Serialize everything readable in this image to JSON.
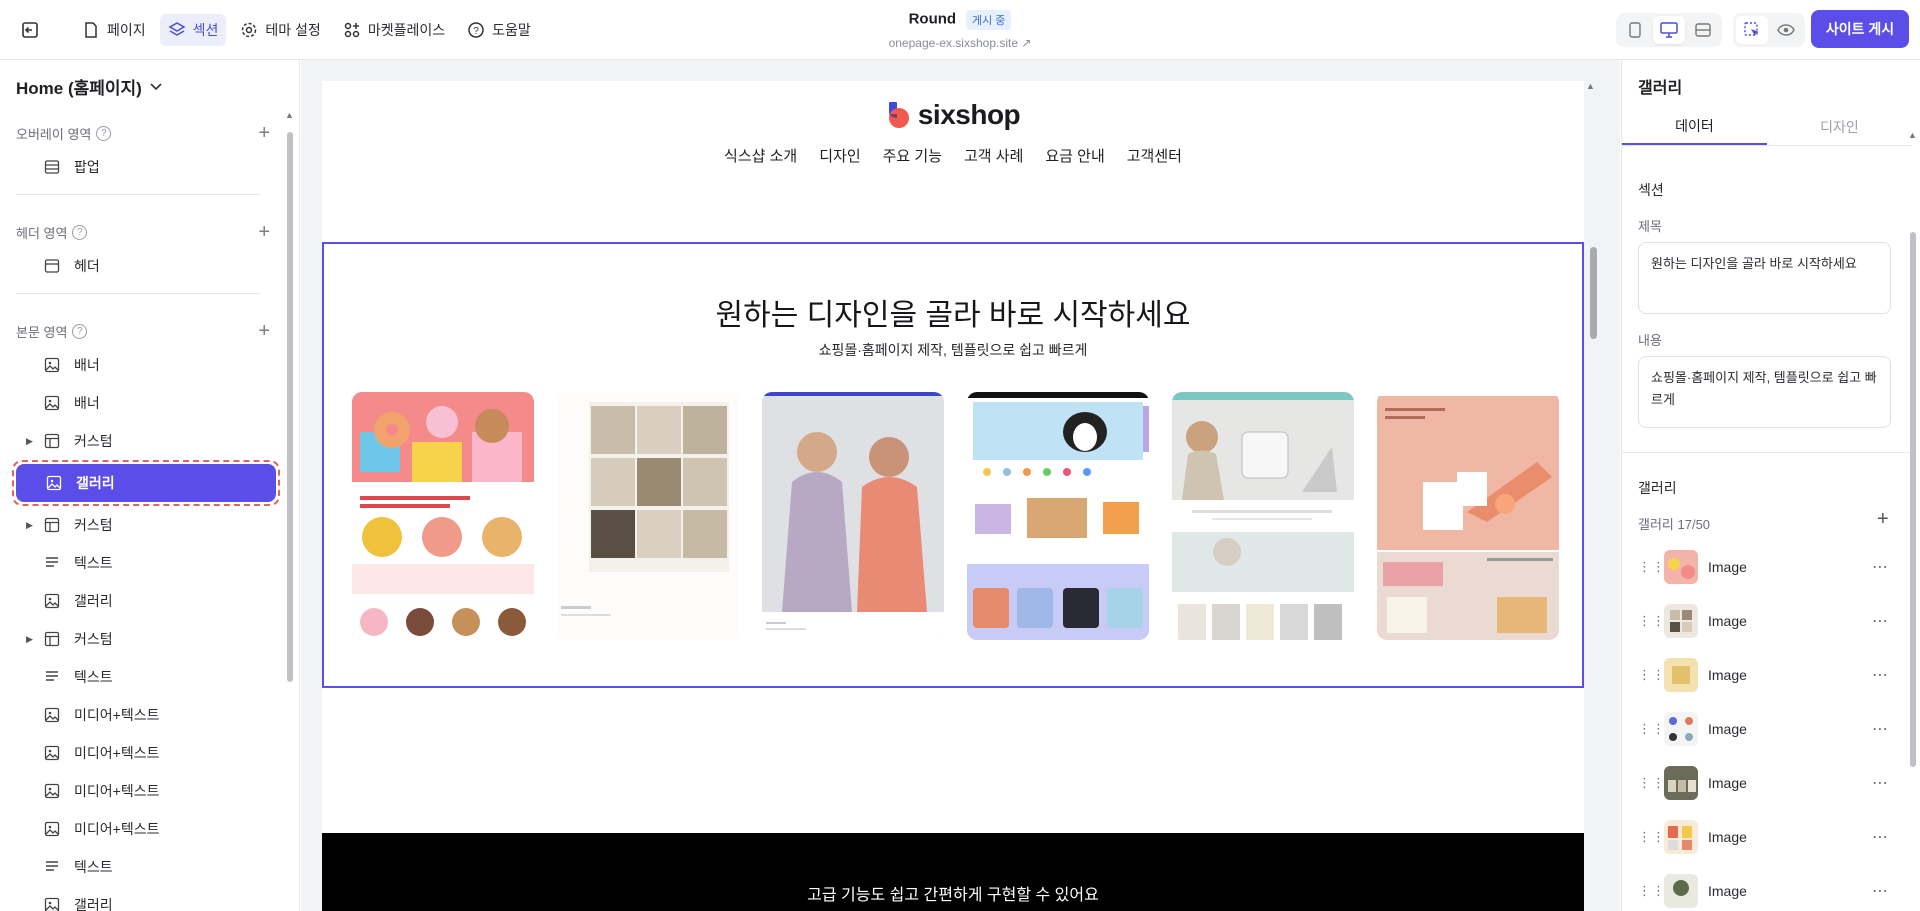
{
  "topbar": {
    "nav": [
      {
        "label": "페이지",
        "icon": "page-icon"
      },
      {
        "label": "섹션",
        "icon": "layers-icon"
      },
      {
        "label": "테마 설정",
        "icon": "gear-icon"
      },
      {
        "label": "마켓플레이스",
        "icon": "apps-icon"
      },
      {
        "label": "도움말",
        "icon": "help-icon"
      }
    ],
    "site_name": "Round",
    "status_badge": "게시 중",
    "site_url": "onepage-ex.sixshop.site",
    "publish_label": "사이트 게시"
  },
  "left": {
    "page_name": "Home (홈페이지)",
    "groups": [
      {
        "title": "오버레이 영역",
        "items": [
          {
            "label": "팝업",
            "icon": "popup-icon"
          }
        ]
      },
      {
        "title": "헤더 영역",
        "items": [
          {
            "label": "헤더",
            "icon": "header-icon"
          }
        ]
      },
      {
        "title": "본문 영역",
        "items": [
          {
            "label": "배너",
            "icon": "image-icon"
          },
          {
            "label": "배너",
            "icon": "image-icon"
          },
          {
            "label": "커스텀",
            "icon": "layout-icon"
          },
          {
            "label": "갤러리",
            "icon": "image-icon"
          },
          {
            "label": "커스텀",
            "icon": "layout-icon"
          },
          {
            "label": "텍스트",
            "icon": "text-icon"
          },
          {
            "label": "갤러리",
            "icon": "image-icon"
          },
          {
            "label": "커스텀",
            "icon": "layout-icon"
          },
          {
            "label": "텍스트",
            "icon": "text-icon"
          },
          {
            "label": "미디어+텍스트",
            "icon": "image-icon"
          },
          {
            "label": "미디어+텍스트",
            "icon": "image-icon"
          },
          {
            "label": "미디어+텍스트",
            "icon": "image-icon"
          },
          {
            "label": "미디어+텍스트",
            "icon": "image-icon"
          },
          {
            "label": "텍스트",
            "icon": "text-icon"
          },
          {
            "label": "갤러리",
            "icon": "image-icon"
          }
        ]
      }
    ]
  },
  "preview": {
    "brand": "sixshop",
    "nav": [
      "식스샵 소개",
      "디자인",
      "주요 기능",
      "고객 사례",
      "요금 안내",
      "고객센터"
    ],
    "gallery_title": "원하는 디자인을 골라 바로 시작하세요",
    "gallery_subtitle": "쇼핑몰·홈페이지 제작, 템플릿으로 쉽고 빠르게",
    "footer_text": "고급 기능도 쉽고 간편하게 구현할 수 있어요"
  },
  "right": {
    "panel_title": "갤러리",
    "tabs": [
      "데이터",
      "디자인"
    ],
    "section_label": "섹션",
    "title_label": "제목",
    "title_value": "원하는 디자인을 골라 바로 시작하세요",
    "content_label": "내용",
    "content_value": "쇼핑몰·홈페이지 제작, 템플릿으로 쉽고 빠르게",
    "gallery_label": "갤러리",
    "gallery_count": "갤러리 17/50",
    "images": [
      "Image",
      "Image",
      "Image",
      "Image",
      "Image",
      "Image",
      "Image"
    ]
  },
  "colors": {
    "accent": "#5b4de8",
    "selection_dash": "#e0645a"
  }
}
